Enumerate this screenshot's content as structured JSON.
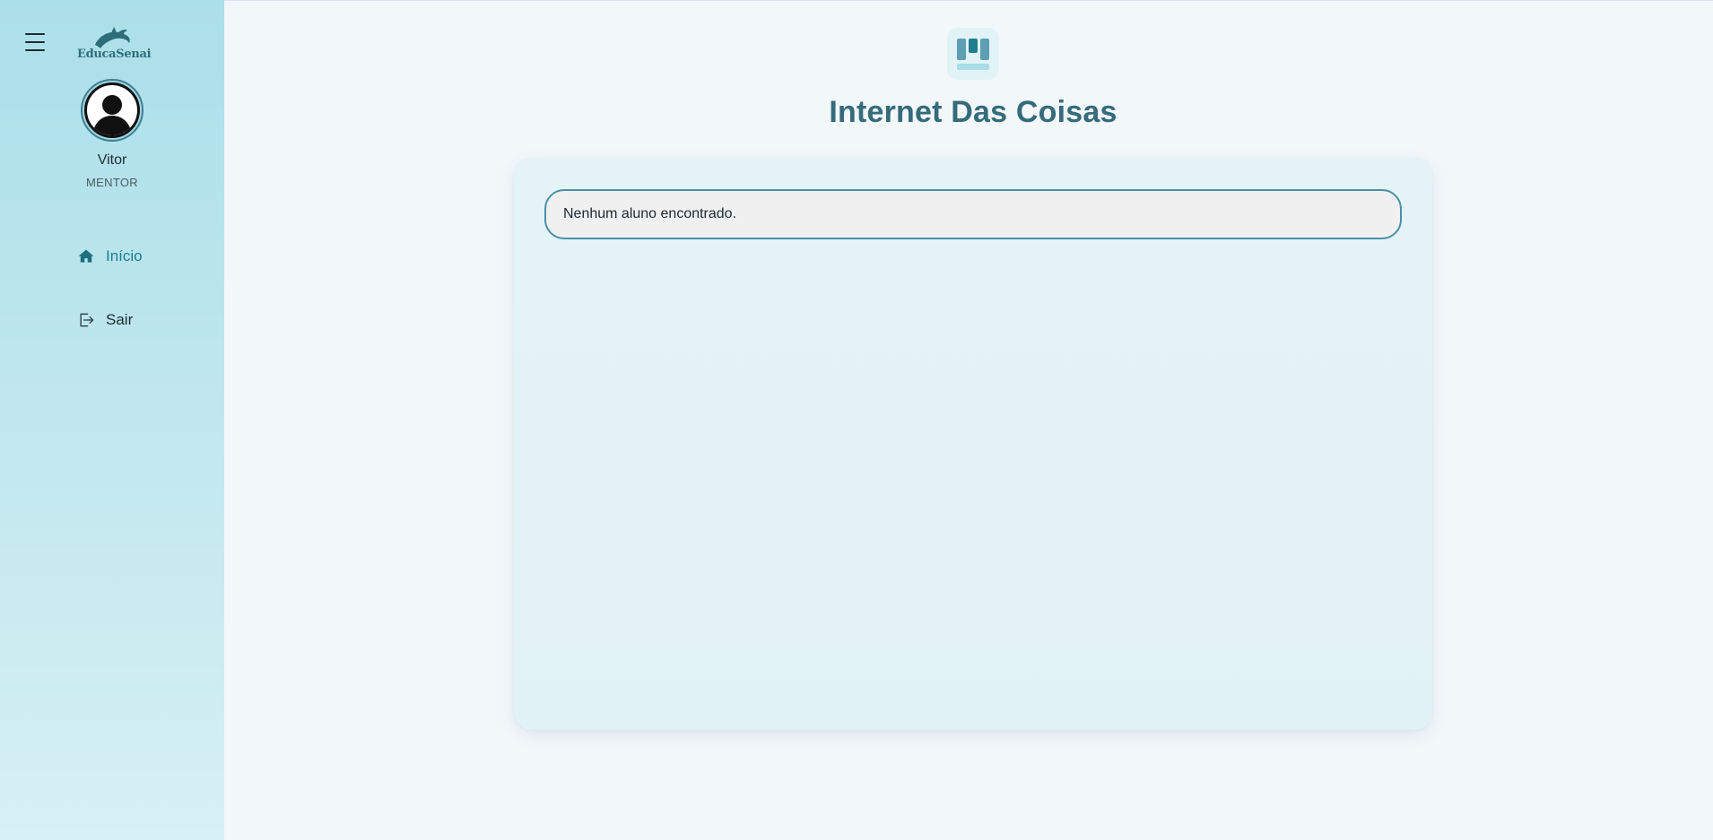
{
  "sidebar": {
    "logo_text": "EducaSenai",
    "user": {
      "name": "Vitor",
      "role": "MENTOR"
    },
    "nav": [
      {
        "label": "Início",
        "icon": "home-icon",
        "active": true
      },
      {
        "label": "Sair",
        "icon": "logout-icon",
        "active": false
      }
    ]
  },
  "main": {
    "icon": "kanban-board-icon",
    "title": "Internet Das Coisas",
    "empty_message": "Nenhum aluno encontrado."
  },
  "colors": {
    "accent": "#1a7d93",
    "title": "#356b7b",
    "sidebar_top": "#abdfe9",
    "sidebar_bottom": "#d6f0f5",
    "border": "#4a90a8"
  }
}
